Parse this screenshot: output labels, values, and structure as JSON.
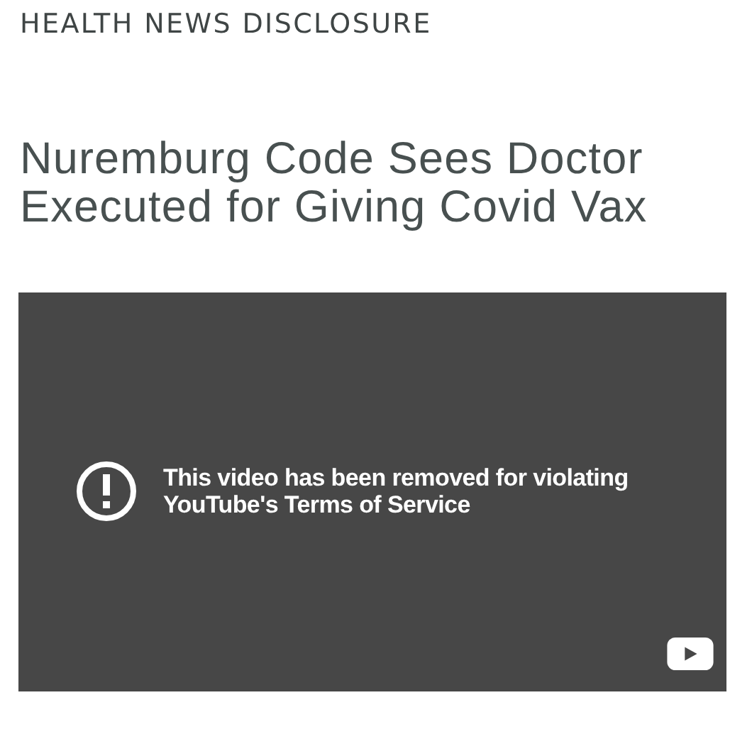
{
  "site_name": "HEALTH NEWS DISCLOSURE",
  "headline": "Nuremburg Code Sees Doctor Executed for Giving Covid Vax",
  "video": {
    "message": "This video has been removed for violating YouTube's Terms of Service"
  }
}
